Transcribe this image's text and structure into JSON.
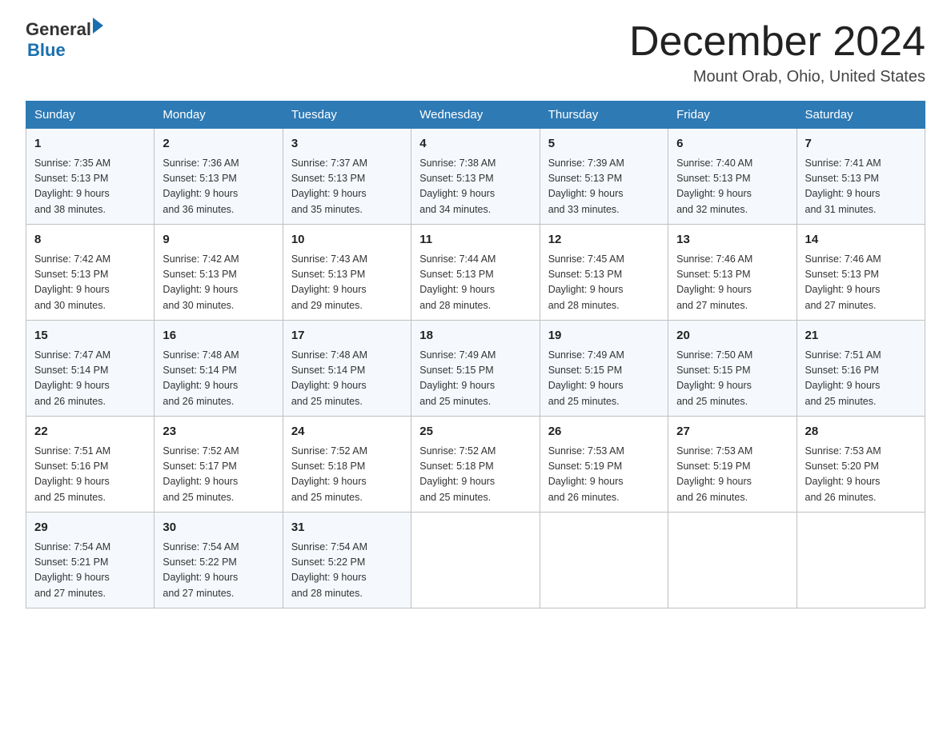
{
  "header": {
    "logo_general": "General",
    "logo_blue": "Blue",
    "month_title": "December 2024",
    "location": "Mount Orab, Ohio, United States"
  },
  "days_of_week": [
    "Sunday",
    "Monday",
    "Tuesday",
    "Wednesday",
    "Thursday",
    "Friday",
    "Saturday"
  ],
  "weeks": [
    [
      {
        "day": "1",
        "sunrise": "7:35 AM",
        "sunset": "5:13 PM",
        "daylight": "9 hours and 38 minutes."
      },
      {
        "day": "2",
        "sunrise": "7:36 AM",
        "sunset": "5:13 PM",
        "daylight": "9 hours and 36 minutes."
      },
      {
        "day": "3",
        "sunrise": "7:37 AM",
        "sunset": "5:13 PM",
        "daylight": "9 hours and 35 minutes."
      },
      {
        "day": "4",
        "sunrise": "7:38 AM",
        "sunset": "5:13 PM",
        "daylight": "9 hours and 34 minutes."
      },
      {
        "day": "5",
        "sunrise": "7:39 AM",
        "sunset": "5:13 PM",
        "daylight": "9 hours and 33 minutes."
      },
      {
        "day": "6",
        "sunrise": "7:40 AM",
        "sunset": "5:13 PM",
        "daylight": "9 hours and 32 minutes."
      },
      {
        "day": "7",
        "sunrise": "7:41 AM",
        "sunset": "5:13 PM",
        "daylight": "9 hours and 31 minutes."
      }
    ],
    [
      {
        "day": "8",
        "sunrise": "7:42 AM",
        "sunset": "5:13 PM",
        "daylight": "9 hours and 30 minutes."
      },
      {
        "day": "9",
        "sunrise": "7:42 AM",
        "sunset": "5:13 PM",
        "daylight": "9 hours and 30 minutes."
      },
      {
        "day": "10",
        "sunrise": "7:43 AM",
        "sunset": "5:13 PM",
        "daylight": "9 hours and 29 minutes."
      },
      {
        "day": "11",
        "sunrise": "7:44 AM",
        "sunset": "5:13 PM",
        "daylight": "9 hours and 28 minutes."
      },
      {
        "day": "12",
        "sunrise": "7:45 AM",
        "sunset": "5:13 PM",
        "daylight": "9 hours and 28 minutes."
      },
      {
        "day": "13",
        "sunrise": "7:46 AM",
        "sunset": "5:13 PM",
        "daylight": "9 hours and 27 minutes."
      },
      {
        "day": "14",
        "sunrise": "7:46 AM",
        "sunset": "5:13 PM",
        "daylight": "9 hours and 27 minutes."
      }
    ],
    [
      {
        "day": "15",
        "sunrise": "7:47 AM",
        "sunset": "5:14 PM",
        "daylight": "9 hours and 26 minutes."
      },
      {
        "day": "16",
        "sunrise": "7:48 AM",
        "sunset": "5:14 PM",
        "daylight": "9 hours and 26 minutes."
      },
      {
        "day": "17",
        "sunrise": "7:48 AM",
        "sunset": "5:14 PM",
        "daylight": "9 hours and 25 minutes."
      },
      {
        "day": "18",
        "sunrise": "7:49 AM",
        "sunset": "5:15 PM",
        "daylight": "9 hours and 25 minutes."
      },
      {
        "day": "19",
        "sunrise": "7:49 AM",
        "sunset": "5:15 PM",
        "daylight": "9 hours and 25 minutes."
      },
      {
        "day": "20",
        "sunrise": "7:50 AM",
        "sunset": "5:15 PM",
        "daylight": "9 hours and 25 minutes."
      },
      {
        "day": "21",
        "sunrise": "7:51 AM",
        "sunset": "5:16 PM",
        "daylight": "9 hours and 25 minutes."
      }
    ],
    [
      {
        "day": "22",
        "sunrise": "7:51 AM",
        "sunset": "5:16 PM",
        "daylight": "9 hours and 25 minutes."
      },
      {
        "day": "23",
        "sunrise": "7:52 AM",
        "sunset": "5:17 PM",
        "daylight": "9 hours and 25 minutes."
      },
      {
        "day": "24",
        "sunrise": "7:52 AM",
        "sunset": "5:18 PM",
        "daylight": "9 hours and 25 minutes."
      },
      {
        "day": "25",
        "sunrise": "7:52 AM",
        "sunset": "5:18 PM",
        "daylight": "9 hours and 25 minutes."
      },
      {
        "day": "26",
        "sunrise": "7:53 AM",
        "sunset": "5:19 PM",
        "daylight": "9 hours and 26 minutes."
      },
      {
        "day": "27",
        "sunrise": "7:53 AM",
        "sunset": "5:19 PM",
        "daylight": "9 hours and 26 minutes."
      },
      {
        "day": "28",
        "sunrise": "7:53 AM",
        "sunset": "5:20 PM",
        "daylight": "9 hours and 26 minutes."
      }
    ],
    [
      {
        "day": "29",
        "sunrise": "7:54 AM",
        "sunset": "5:21 PM",
        "daylight": "9 hours and 27 minutes."
      },
      {
        "day": "30",
        "sunrise": "7:54 AM",
        "sunset": "5:22 PM",
        "daylight": "9 hours and 27 minutes."
      },
      {
        "day": "31",
        "sunrise": "7:54 AM",
        "sunset": "5:22 PM",
        "daylight": "9 hours and 28 minutes."
      },
      null,
      null,
      null,
      null
    ]
  ],
  "labels": {
    "sunrise": "Sunrise:",
    "sunset": "Sunset:",
    "daylight": "Daylight:"
  }
}
